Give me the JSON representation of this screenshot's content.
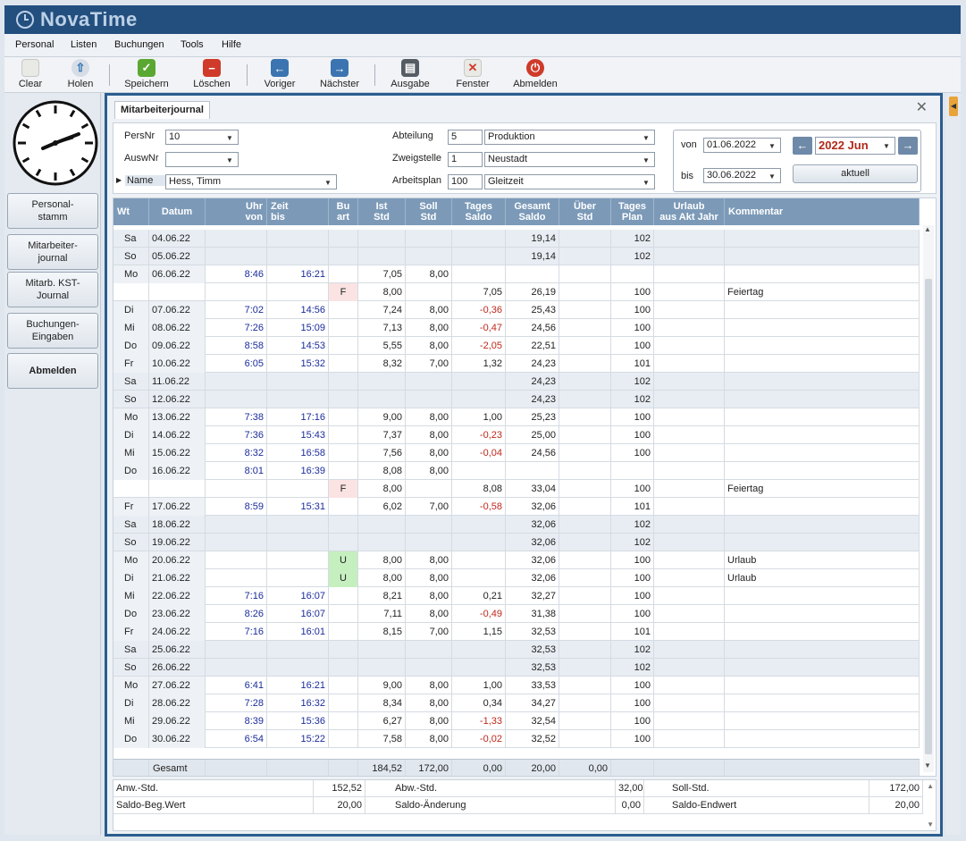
{
  "app": {
    "title": "NovaTime"
  },
  "menu": [
    "Personal",
    "Listen",
    "Buchungen",
    "Tools",
    "Hilfe"
  ],
  "toolbar": [
    {
      "label": "Clear",
      "icon": "clear-icon"
    },
    {
      "label": "Holen",
      "icon": "arrow-up-icon"
    },
    {
      "label": "Speichern",
      "icon": "checkmark-icon"
    },
    {
      "label": "Löschen",
      "icon": "delete-icon"
    },
    {
      "label": "Voriger",
      "icon": "arrow-left-icon"
    },
    {
      "label": "Nächster",
      "icon": "arrow-right-icon"
    },
    {
      "label": "Ausgabe",
      "icon": "printer-icon"
    },
    {
      "label": "Fenster",
      "icon": "close-window-icon"
    },
    {
      "label": "Abmelden",
      "icon": "power-icon"
    }
  ],
  "sidebar": [
    {
      "label": "Personal-\nstamm"
    },
    {
      "label": "Mitarbeiter-\njournal"
    },
    {
      "label": "Mitarb. KST-\nJournal"
    },
    {
      "label": "Buchungen-\nEingaben"
    },
    {
      "label": "Abmelden"
    }
  ],
  "tab": {
    "label": "Mitarbeiterjournal"
  },
  "form": {
    "persnr_label": "PersNr",
    "persnr_value": "10",
    "auswnr_label": "AuswNr",
    "auswnr_value": "",
    "name_label": "Name",
    "name_value": "Hess, Timm",
    "abteilung_label": "Abteilung",
    "abteilung_nr": "5",
    "abteilung_name": "Produktion",
    "zweigstelle_label": "Zweigstelle",
    "zweigstelle_nr": "1",
    "zweigstelle_name": "Neustadt",
    "arbeitsplan_label": "Arbeitsplan",
    "arbeitsplan_nr": "100",
    "arbeitsplan_name": "Gleitzeit",
    "von_label": "von",
    "von_value": "01.06.2022",
    "bis_label": "bis",
    "bis_value": "30.06.2022",
    "period_value": "2022 Jun",
    "aktuell_label": "aktuell"
  },
  "table": {
    "headers": [
      "Wt",
      "Datum",
      "Uhr\nvon",
      "Zeit\nbis",
      "Bu\nart",
      "Ist\nStd",
      "Soll\nStd",
      "Tages\nSaldo",
      "Gesamt\nSaldo",
      "Über\nStd",
      "Tages\nPlan",
      "Urlaub\naus Akt Jahr",
      "Kommentar"
    ],
    "rows": [
      {
        "wt": "Sa",
        "datum": "04.06.22",
        "von": "",
        "bis": "",
        "buart": "",
        "ist": "",
        "soll": "",
        "tsaldo": "",
        "gsaldo": "19,14",
        "ueber": "",
        "plan": "102",
        "urlaub": "",
        "kommentar": "",
        "we": true
      },
      {
        "wt": "So",
        "datum": "05.06.22",
        "von": "",
        "bis": "",
        "buart": "",
        "ist": "",
        "soll": "",
        "tsaldo": "",
        "gsaldo": "19,14",
        "ueber": "",
        "plan": "102",
        "urlaub": "",
        "kommentar": "",
        "we": true
      },
      {
        "wt": "Mo",
        "datum": "06.06.22",
        "von": "8:46",
        "bis": "16:21",
        "buart": "",
        "ist": "7,05",
        "soll": "8,00",
        "tsaldo": "",
        "gsaldo": "",
        "ueber": "",
        "plan": "",
        "urlaub": "",
        "kommentar": ""
      },
      {
        "wt": "",
        "datum": "",
        "von": "",
        "bis": "",
        "buart": "F",
        "ist": "8,00",
        "soll": "",
        "tsaldo": "7,05",
        "gsaldo": "26,19",
        "ueber": "",
        "plan": "100",
        "urlaub": "",
        "kommentar": "Feiertag"
      },
      {
        "wt": "Di",
        "datum": "07.06.22",
        "von": "7:02",
        "bis": "14:56",
        "buart": "",
        "ist": "7,24",
        "soll": "8,00",
        "tsaldo": "-0,36",
        "gsaldo": "25,43",
        "ueber": "",
        "plan": "100",
        "urlaub": "",
        "kommentar": ""
      },
      {
        "wt": "Mi",
        "datum": "08.06.22",
        "von": "7:26",
        "bis": "15:09",
        "buart": "",
        "ist": "7,13",
        "soll": "8,00",
        "tsaldo": "-0,47",
        "gsaldo": "24,56",
        "ueber": "",
        "plan": "100",
        "urlaub": "",
        "kommentar": ""
      },
      {
        "wt": "Do",
        "datum": "09.06.22",
        "von": "8:58",
        "bis": "14:53",
        "buart": "",
        "ist": "5,55",
        "soll": "8,00",
        "tsaldo": "-2,05",
        "gsaldo": "22,51",
        "ueber": "",
        "plan": "100",
        "urlaub": "",
        "kommentar": ""
      },
      {
        "wt": "Fr",
        "datum": "10.06.22",
        "von": "6:05",
        "bis": "15:32",
        "buart": "",
        "ist": "8,32",
        "soll": "7,00",
        "tsaldo": "1,32",
        "gsaldo": "24,23",
        "ueber": "",
        "plan": "101",
        "urlaub": "",
        "kommentar": ""
      },
      {
        "wt": "Sa",
        "datum": "11.06.22",
        "von": "",
        "bis": "",
        "buart": "",
        "ist": "",
        "soll": "",
        "tsaldo": "",
        "gsaldo": "24,23",
        "ueber": "",
        "plan": "102",
        "urlaub": "",
        "kommentar": "",
        "we": true
      },
      {
        "wt": "So",
        "datum": "12.06.22",
        "von": "",
        "bis": "",
        "buart": "",
        "ist": "",
        "soll": "",
        "tsaldo": "",
        "gsaldo": "24,23",
        "ueber": "",
        "plan": "102",
        "urlaub": "",
        "kommentar": "",
        "we": true
      },
      {
        "wt": "Mo",
        "datum": "13.06.22",
        "von": "7:38",
        "bis": "17:16",
        "buart": "",
        "ist": "9,00",
        "soll": "8,00",
        "tsaldo": "1,00",
        "gsaldo": "25,23",
        "ueber": "",
        "plan": "100",
        "urlaub": "",
        "kommentar": ""
      },
      {
        "wt": "Di",
        "datum": "14.06.22",
        "von": "7:36",
        "bis": "15:43",
        "buart": "",
        "ist": "7,37",
        "soll": "8,00",
        "tsaldo": "-0,23",
        "gsaldo": "25,00",
        "ueber": "",
        "plan": "100",
        "urlaub": "",
        "kommentar": ""
      },
      {
        "wt": "Mi",
        "datum": "15.06.22",
        "von": "8:32",
        "bis": "16:58",
        "buart": "",
        "ist": "7,56",
        "soll": "8,00",
        "tsaldo": "-0,04",
        "gsaldo": "24,56",
        "ueber": "",
        "plan": "100",
        "urlaub": "",
        "kommentar": ""
      },
      {
        "wt": "Do",
        "datum": "16.06.22",
        "von": "8:01",
        "bis": "16:39",
        "buart": "",
        "ist": "8,08",
        "soll": "8,00",
        "tsaldo": "",
        "gsaldo": "",
        "ueber": "",
        "plan": "",
        "urlaub": "",
        "kommentar": ""
      },
      {
        "wt": "",
        "datum": "",
        "von": "",
        "bis": "",
        "buart": "F",
        "ist": "8,00",
        "soll": "",
        "tsaldo": "8,08",
        "gsaldo": "33,04",
        "ueber": "",
        "plan": "100",
        "urlaub": "",
        "kommentar": "Feiertag"
      },
      {
        "wt": "Fr",
        "datum": "17.06.22",
        "von": "8:59",
        "bis": "15:31",
        "buart": "",
        "ist": "6,02",
        "soll": "7,00",
        "tsaldo": "-0,58",
        "gsaldo": "32,06",
        "ueber": "",
        "plan": "101",
        "urlaub": "",
        "kommentar": ""
      },
      {
        "wt": "Sa",
        "datum": "18.06.22",
        "von": "",
        "bis": "",
        "buart": "",
        "ist": "",
        "soll": "",
        "tsaldo": "",
        "gsaldo": "32,06",
        "ueber": "",
        "plan": "102",
        "urlaub": "",
        "kommentar": "",
        "we": true
      },
      {
        "wt": "So",
        "datum": "19.06.22",
        "von": "",
        "bis": "",
        "buart": "",
        "ist": "",
        "soll": "",
        "tsaldo": "",
        "gsaldo": "32,06",
        "ueber": "",
        "plan": "102",
        "urlaub": "",
        "kommentar": "",
        "we": true
      },
      {
        "wt": "Mo",
        "datum": "20.06.22",
        "von": "",
        "bis": "",
        "buart": "U",
        "ist": "8,00",
        "soll": "8,00",
        "tsaldo": "",
        "gsaldo": "32,06",
        "ueber": "",
        "plan": "100",
        "urlaub": "",
        "kommentar": "Urlaub"
      },
      {
        "wt": "Di",
        "datum": "21.06.22",
        "von": "",
        "bis": "",
        "buart": "U",
        "ist": "8,00",
        "soll": "8,00",
        "tsaldo": "",
        "gsaldo": "32,06",
        "ueber": "",
        "plan": "100",
        "urlaub": "",
        "kommentar": "Urlaub"
      },
      {
        "wt": "Mi",
        "datum": "22.06.22",
        "von": "7:16",
        "bis": "16:07",
        "buart": "",
        "ist": "8,21",
        "soll": "8,00",
        "tsaldo": "0,21",
        "gsaldo": "32,27",
        "ueber": "",
        "plan": "100",
        "urlaub": "",
        "kommentar": ""
      },
      {
        "wt": "Do",
        "datum": "23.06.22",
        "von": "8:26",
        "bis": "16:07",
        "buart": "",
        "ist": "7,11",
        "soll": "8,00",
        "tsaldo": "-0,49",
        "gsaldo": "31,38",
        "ueber": "",
        "plan": "100",
        "urlaub": "",
        "kommentar": ""
      },
      {
        "wt": "Fr",
        "datum": "24.06.22",
        "von": "7:16",
        "bis": "16:01",
        "buart": "",
        "ist": "8,15",
        "soll": "7,00",
        "tsaldo": "1,15",
        "gsaldo": "32,53",
        "ueber": "",
        "plan": "101",
        "urlaub": "",
        "kommentar": ""
      },
      {
        "wt": "Sa",
        "datum": "25.06.22",
        "von": "",
        "bis": "",
        "buart": "",
        "ist": "",
        "soll": "",
        "tsaldo": "",
        "gsaldo": "32,53",
        "ueber": "",
        "plan": "102",
        "urlaub": "",
        "kommentar": "",
        "we": true
      },
      {
        "wt": "So",
        "datum": "26.06.22",
        "von": "",
        "bis": "",
        "buart": "",
        "ist": "",
        "soll": "",
        "tsaldo": "",
        "gsaldo": "32,53",
        "ueber": "",
        "plan": "102",
        "urlaub": "",
        "kommentar": "",
        "we": true
      },
      {
        "wt": "Mo",
        "datum": "27.06.22",
        "von": "6:41",
        "bis": "16:21",
        "buart": "",
        "ist": "9,00",
        "soll": "8,00",
        "tsaldo": "1,00",
        "gsaldo": "33,53",
        "ueber": "",
        "plan": "100",
        "urlaub": "",
        "kommentar": ""
      },
      {
        "wt": "Di",
        "datum": "28.06.22",
        "von": "7:28",
        "bis": "16:32",
        "buart": "",
        "ist": "8,34",
        "soll": "8,00",
        "tsaldo": "0,34",
        "gsaldo": "34,27",
        "ueber": "",
        "plan": "100",
        "urlaub": "",
        "kommentar": ""
      },
      {
        "wt": "Mi",
        "datum": "29.06.22",
        "von": "8:39",
        "bis": "15:36",
        "buart": "",
        "ist": "6,27",
        "soll": "8,00",
        "tsaldo": "-1,33",
        "gsaldo": "32,54",
        "ueber": "",
        "plan": "100",
        "urlaub": "",
        "kommentar": ""
      },
      {
        "wt": "Do",
        "datum": "30.06.22",
        "von": "6:54",
        "bis": "15:22",
        "buart": "",
        "ist": "7,58",
        "soll": "8,00",
        "tsaldo": "-0,02",
        "gsaldo": "32,52",
        "ueber": "",
        "plan": "100",
        "urlaub": "",
        "kommentar": ""
      }
    ],
    "totals": {
      "label": "Gesamt",
      "ist": "184,52",
      "soll": "172,00",
      "tsaldo": "0,00",
      "gsaldo": "20,00",
      "ueber": "0,00"
    }
  },
  "summary": {
    "anw_label": "Anw.-Std.",
    "anw_value": "152,52",
    "abw_label": "Abw.-Std.",
    "abw_value": "32,00",
    "soll_label": "Soll-Std.",
    "soll_value": "172,00",
    "saldobeg_label": "Saldo-Beg.Wert",
    "saldobeg_value": "20,00",
    "saldoaend_label": "Saldo-Änderung",
    "saldoaend_value": "0,00",
    "saldoend_label": "Saldo-Endwert",
    "saldoend_value": "20,00"
  },
  "colors": {
    "titlebar": "#234f7f",
    "header": "#7c9ab8",
    "negative": "#c0281c",
    "time": "#1a2c9a",
    "holiday_bg": "#fbe3e3",
    "vacation_bg": "#c6efc0"
  }
}
